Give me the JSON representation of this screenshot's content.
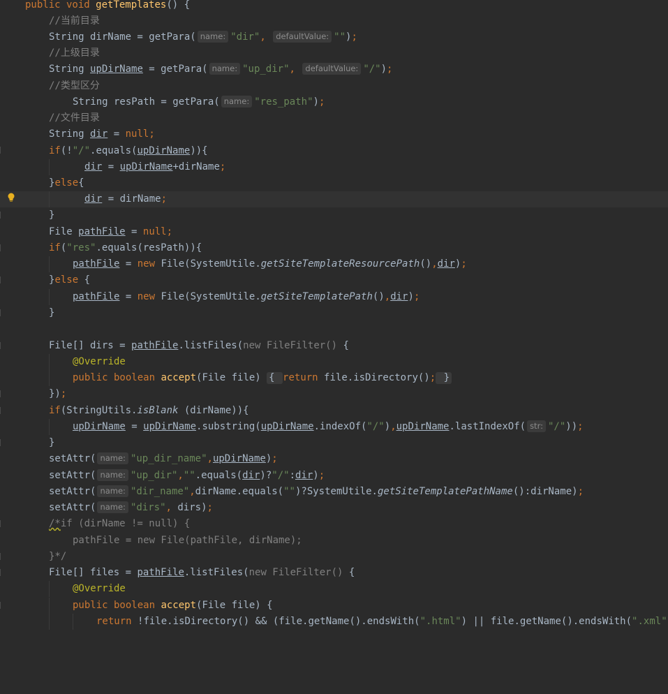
{
  "editor": {
    "lines": [
      {
        "text": "public void getTemplates() {"
      },
      {
        "text": "//当前目录"
      },
      {
        "text": "String dirName = getPara( name: \"dir\", defaultValue: \"\");",
        "hint_name": "name:",
        "hint_default": "defaultValue:"
      },
      {
        "text": "//上级目录"
      },
      {
        "text": "String upDirName = getPara( name: \"up_dir\", defaultValue: \"/\");"
      },
      {
        "text": "//类型区分"
      },
      {
        "text": "String resPath = getPara( name: \"res_path\");"
      },
      {
        "text": "//文件目录"
      },
      {
        "text": "String dir = null;"
      },
      {
        "text": "if(!\"/\".equals(upDirName)){"
      },
      {
        "text": "dir = upDirName+dirName;"
      },
      {
        "text": "}else{"
      },
      {
        "text": "dir = dirName;"
      },
      {
        "text": "}"
      },
      {
        "text": "File pathFile = null;"
      },
      {
        "text": "if(\"res\".equals(resPath)){"
      },
      {
        "text": "pathFile = new File(SystemUtile.getSiteTemplateResourcePath(),dir);"
      },
      {
        "text": "}else {"
      },
      {
        "text": "pathFile = new File(SystemUtile.getSiteTemplatePath(),dir);"
      },
      {
        "text": "}"
      },
      {
        "text": ""
      },
      {
        "text": "File[] dirs = pathFile.listFiles(new FileFilter() {"
      },
      {
        "text": "@Override"
      },
      {
        "text": "public boolean accept(File file) { return file.isDirectory(); }"
      },
      {
        "text": "});"
      },
      {
        "text": "if(StringUtils.isBlank (dirName)){"
      },
      {
        "text": "upDirName = upDirName.substring(upDirName.indexOf(\"/\"),upDirName.lastIndexOf( str: \"/\"));"
      },
      {
        "text": "}"
      },
      {
        "text": "setAttr( name: \"up_dir_name\",upDirName);"
      },
      {
        "text": "setAttr( name: \"up_dir\",\"\".equals(dir)?\"/\":dir);"
      },
      {
        "text": "setAttr( name: \"dir_name\",dirName.equals(\"\")?SystemUtile.getSiteTemplatePathName():dirName);"
      },
      {
        "text": "setAttr( name: \"dirs\", dirs);"
      },
      {
        "text": "/*if (dirName != null) {"
      },
      {
        "text": "pathFile = new File(pathFile, dirName);"
      },
      {
        "text": "}*/"
      },
      {
        "text": "File[] files = pathFile.listFiles(new FileFilter() {"
      },
      {
        "text": "@Override"
      },
      {
        "text": "public boolean accept(File file) {"
      },
      {
        "text": "return !file.isDirectory() && (file.getName().endsWith(\".html\") || file.getName().endsWith(\".xml\""
      }
    ],
    "colors": {
      "background": "#2b2b2b",
      "keyword": "#cc7832",
      "string": "#6a8759",
      "comment": "#808080",
      "annotation": "#bbb529",
      "method_decl": "#ffc66d",
      "text": "#a9b7c6"
    },
    "icons": {
      "intention": "lightbulb-icon"
    }
  }
}
